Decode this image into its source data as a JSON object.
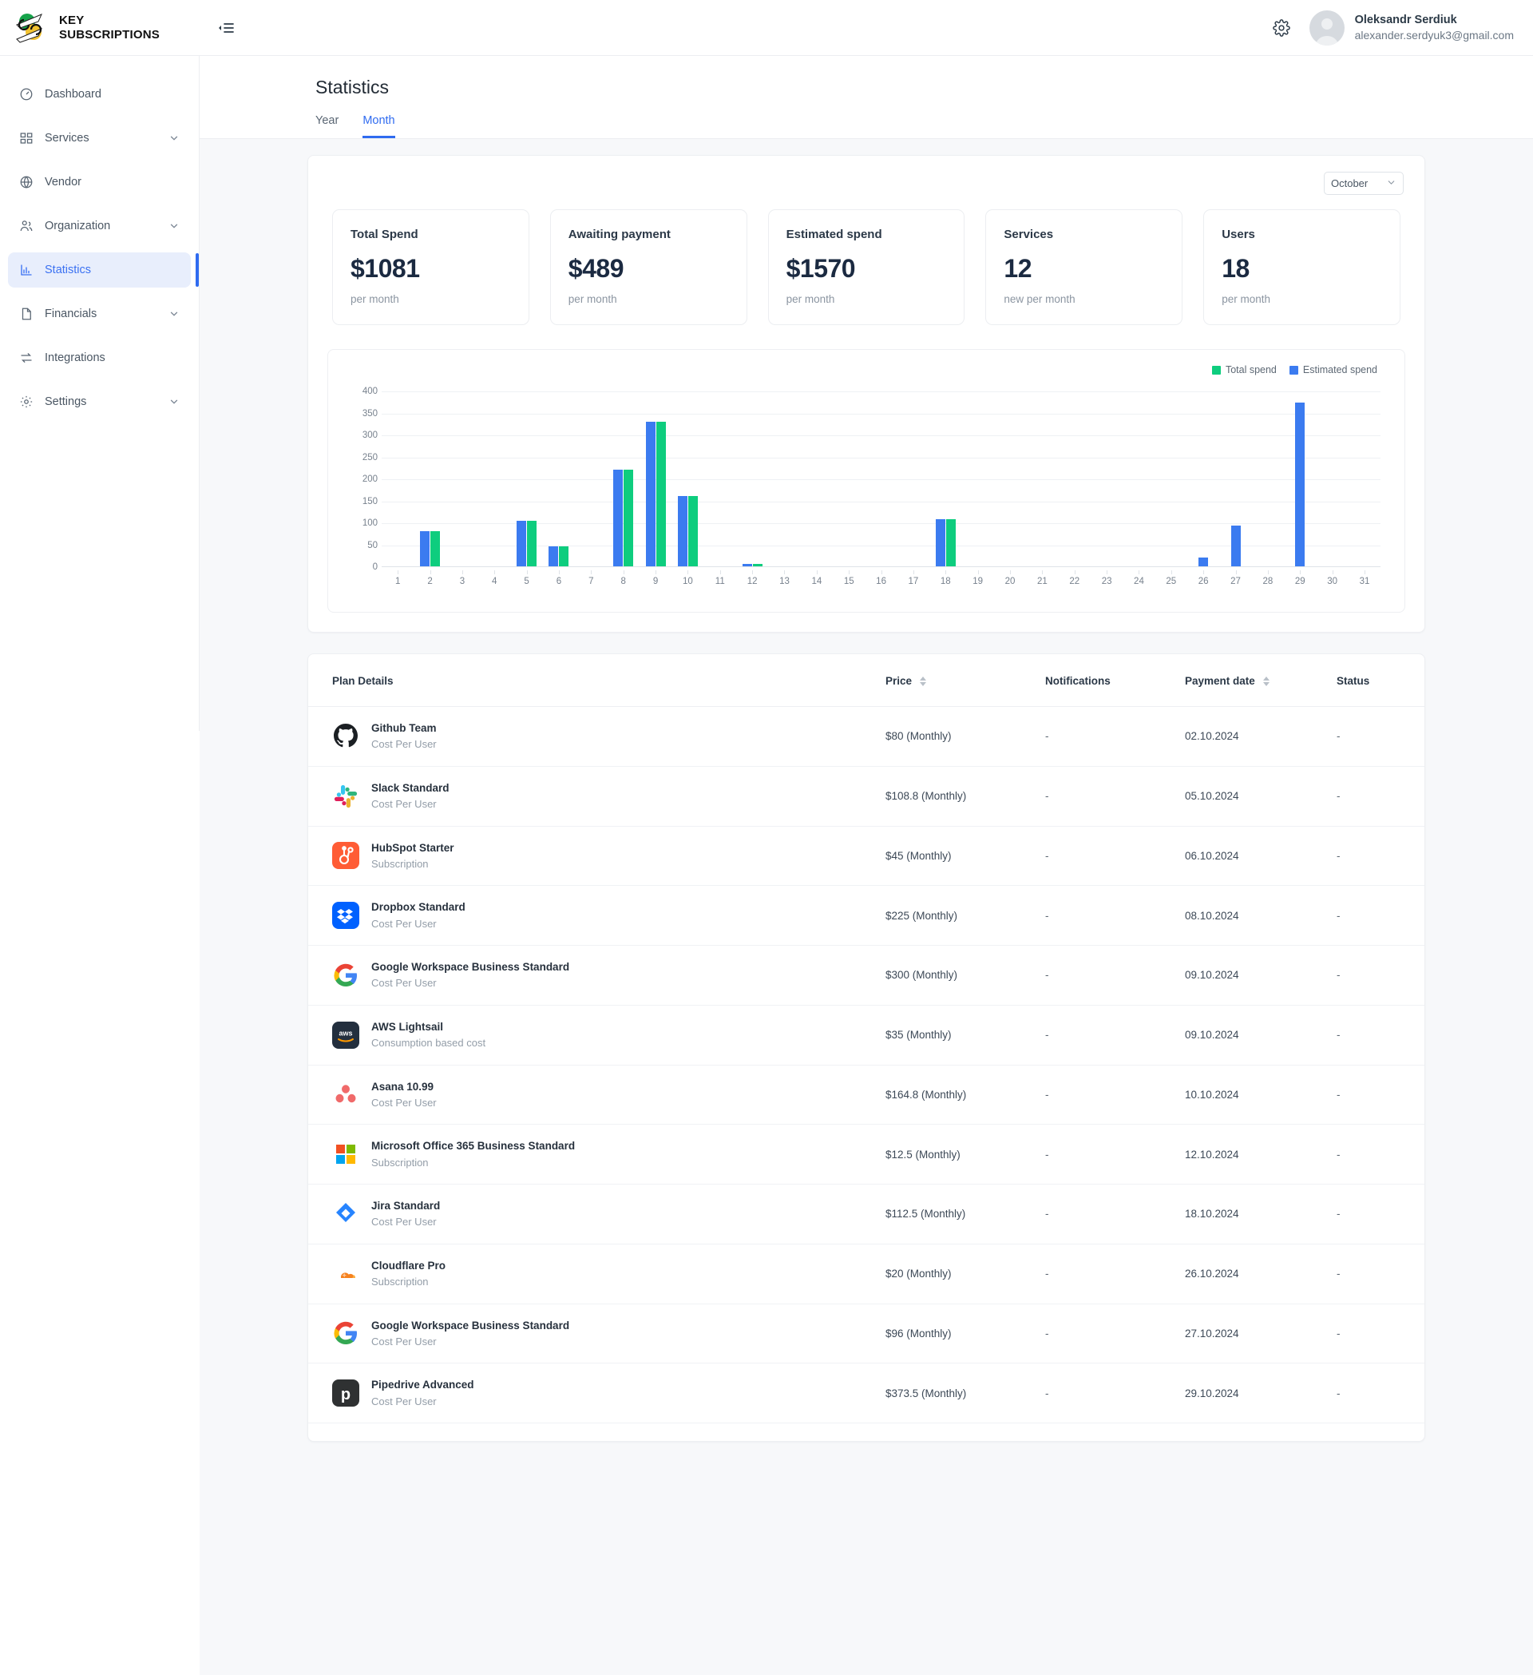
{
  "brand": {
    "line1": "KEY",
    "line2": "SUBSCRIPTIONS"
  },
  "header": {
    "collapse_icon": "collapse-sidebar-icon",
    "gear_icon": "gear-icon",
    "user_name": "Oleksandr Serdiuk",
    "user_email": "alexander.serdyuk3@gmail.com"
  },
  "sidebar": {
    "items": [
      {
        "label": "Dashboard",
        "icon": "gauge-icon",
        "expandable": false,
        "active": false
      },
      {
        "label": "Services",
        "icon": "grid-icon",
        "expandable": true,
        "active": false
      },
      {
        "label": "Vendor",
        "icon": "globe-icon",
        "expandable": false,
        "active": false
      },
      {
        "label": "Organization",
        "icon": "users-icon",
        "expandable": true,
        "active": false
      },
      {
        "label": "Statistics",
        "icon": "bar-chart-icon",
        "expandable": false,
        "active": true
      },
      {
        "label": "Financials",
        "icon": "document-icon",
        "expandable": true,
        "active": false
      },
      {
        "label": "Integrations",
        "icon": "exchange-icon",
        "expandable": false,
        "active": false
      },
      {
        "label": "Settings",
        "icon": "gear-icon",
        "expandable": true,
        "active": false
      }
    ]
  },
  "page": {
    "title": "Statistics",
    "tabs": [
      {
        "label": "Year",
        "active": false
      },
      {
        "label": "Month",
        "active": true
      }
    ]
  },
  "period": {
    "selected": "October"
  },
  "stats": [
    {
      "label": "Total Spend",
      "value": "$1081",
      "sub": "per month"
    },
    {
      "label": "Awaiting payment",
      "value": "$489",
      "sub": "per month"
    },
    {
      "label": "Estimated spend",
      "value": "$1570",
      "sub": "per month"
    },
    {
      "label": "Services",
      "value": "12",
      "sub": "new per month"
    },
    {
      "label": "Users",
      "value": "18",
      "sub": "per month"
    }
  ],
  "chart_data": {
    "type": "bar",
    "title": "",
    "xlabel": "",
    "ylabel": "",
    "ylim": [
      0,
      400
    ],
    "yticks": [
      0,
      50,
      100,
      150,
      200,
      250,
      300,
      350,
      400
    ],
    "grid": true,
    "legend_position": "top-right",
    "colors": {
      "total_spend": "#0ecd7e",
      "estimated_spend": "#3b7bf0"
    },
    "categories": [
      "1",
      "2",
      "3",
      "4",
      "5",
      "6",
      "7",
      "8",
      "9",
      "10",
      "11",
      "12",
      "13",
      "14",
      "15",
      "16",
      "17",
      "18",
      "19",
      "20",
      "21",
      "22",
      "23",
      "24",
      "25",
      "26",
      "27",
      "28",
      "29",
      "30",
      "31"
    ],
    "series": [
      {
        "name": "Estimated spend",
        "values": [
          0,
          80,
          0,
          0,
          103,
          45,
          0,
          220,
          330,
          160,
          0,
          5,
          0,
          0,
          0,
          0,
          0,
          107,
          0,
          0,
          0,
          0,
          0,
          0,
          0,
          20,
          93,
          0,
          373,
          0,
          0
        ]
      },
      {
        "name": "Total spend",
        "values": [
          0,
          80,
          0,
          0,
          103,
          45,
          0,
          220,
          330,
          160,
          0,
          5,
          0,
          0,
          0,
          0,
          0,
          107,
          0,
          0,
          0,
          0,
          0,
          0,
          0,
          0,
          0,
          0,
          0,
          0,
          0
        ]
      }
    ]
  },
  "table": {
    "columns": [
      {
        "label": "Plan Details",
        "sortable": false
      },
      {
        "label": "Price",
        "sortable": true
      },
      {
        "label": "Notifications",
        "sortable": false
      },
      {
        "label": "Payment date",
        "sortable": true
      },
      {
        "label": "Status",
        "sortable": false
      }
    ],
    "rows": [
      {
        "icon": "github-icon",
        "name": "Github Team",
        "type": "Cost Per User",
        "price": "$80 (Monthly)",
        "notifications": "-",
        "payment_date": "02.10.2024",
        "status": "-"
      },
      {
        "icon": "slack-icon",
        "name": "Slack Standard",
        "type": "Cost Per User",
        "price": "$108.8 (Monthly)",
        "notifications": "-",
        "payment_date": "05.10.2024",
        "status": "-"
      },
      {
        "icon": "hubspot-icon",
        "name": "HubSpot Starter",
        "type": "Subscription",
        "price": "$45 (Monthly)",
        "notifications": "-",
        "payment_date": "06.10.2024",
        "status": "-"
      },
      {
        "icon": "dropbox-icon",
        "name": "Dropbox Standard",
        "type": "Cost Per User",
        "price": "$225 (Monthly)",
        "notifications": "-",
        "payment_date": "08.10.2024",
        "status": "-"
      },
      {
        "icon": "google-icon",
        "name": "Google Workspace Business Standard",
        "type": "Cost Per User",
        "price": "$300 (Monthly)",
        "notifications": "-",
        "payment_date": "09.10.2024",
        "status": "-"
      },
      {
        "icon": "aws-icon",
        "name": "AWS Lightsail",
        "type": "Consumption based cost",
        "price": "$35 (Monthly)",
        "notifications": "-",
        "payment_date": "09.10.2024",
        "status": "-"
      },
      {
        "icon": "asana-icon",
        "name": "Asana 10.99",
        "type": "Cost Per User",
        "price": "$164.8 (Monthly)",
        "notifications": "-",
        "payment_date": "10.10.2024",
        "status": "-"
      },
      {
        "icon": "microsoft-icon",
        "name": "Microsoft Office 365 Business Standard",
        "type": "Subscription",
        "price": "$12.5 (Monthly)",
        "notifications": "-",
        "payment_date": "12.10.2024",
        "status": "-"
      },
      {
        "icon": "jira-icon",
        "name": "Jira Standard",
        "type": "Cost Per User",
        "price": "$112.5 (Monthly)",
        "notifications": "-",
        "payment_date": "18.10.2024",
        "status": "-"
      },
      {
        "icon": "cloudflare-icon",
        "name": "Cloudflare Pro",
        "type": "Subscription",
        "price": "$20 (Monthly)",
        "notifications": "-",
        "payment_date": "26.10.2024",
        "status": "-"
      },
      {
        "icon": "google-icon",
        "name": "Google Workspace Business Standard",
        "type": "Cost Per User",
        "price": "$96 (Monthly)",
        "notifications": "-",
        "payment_date": "27.10.2024",
        "status": "-"
      },
      {
        "icon": "pipedrive-icon",
        "name": "Pipedrive Advanced",
        "type": "Cost Per User",
        "price": "$373.5 (Monthly)",
        "notifications": "-",
        "payment_date": "29.10.2024",
        "status": "-"
      }
    ]
  }
}
